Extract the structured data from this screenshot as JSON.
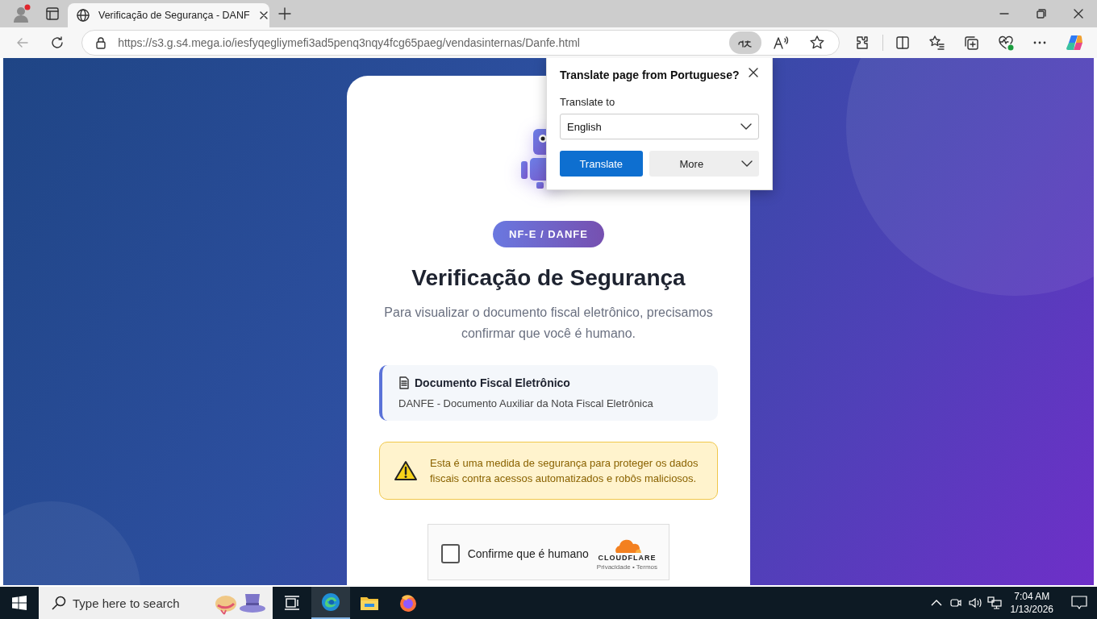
{
  "browser": {
    "tabs": [
      {
        "title": "Verificação de Segurança - DANF",
        "selected": true
      }
    ],
    "address": "https://s3.g.s4.mega.io/iesfyqegliymefi3ad5penq3nqy4fcg65paeg/vendasinternas/Danfe.html"
  },
  "translate_popup": {
    "title": "Translate page from Portuguese?",
    "label": "Translate to",
    "language": "English",
    "buttons": [
      {
        "label": "Translate",
        "kind": "primary"
      },
      {
        "label": "More",
        "kind": "menu"
      }
    ]
  },
  "page": {
    "badge": "NF-E / DANFE",
    "title": "Verificação de Segurança",
    "subtitle": "Para visualizar o documento fiscal eletrônico, precisamos confirmar que você é humano.",
    "document": {
      "title": "Documento Fiscal Eletrônico",
      "description": "DANFE - Documento Auxiliar da Nota Fiscal Eletrônica"
    },
    "warning": "Esta é uma medida de segurança para proteger os dados fiscais contra acessos automatizados e robôs maliciosos.",
    "captcha": {
      "label": "Confirme que é humano",
      "checked": false,
      "brand": "CLOUDFLARE",
      "footer": "Privacidade • Termos"
    }
  },
  "taskbar": {
    "search_placeholder": "Type here to search",
    "time": "7:04 AM",
    "date": "1/13/2026"
  }
}
